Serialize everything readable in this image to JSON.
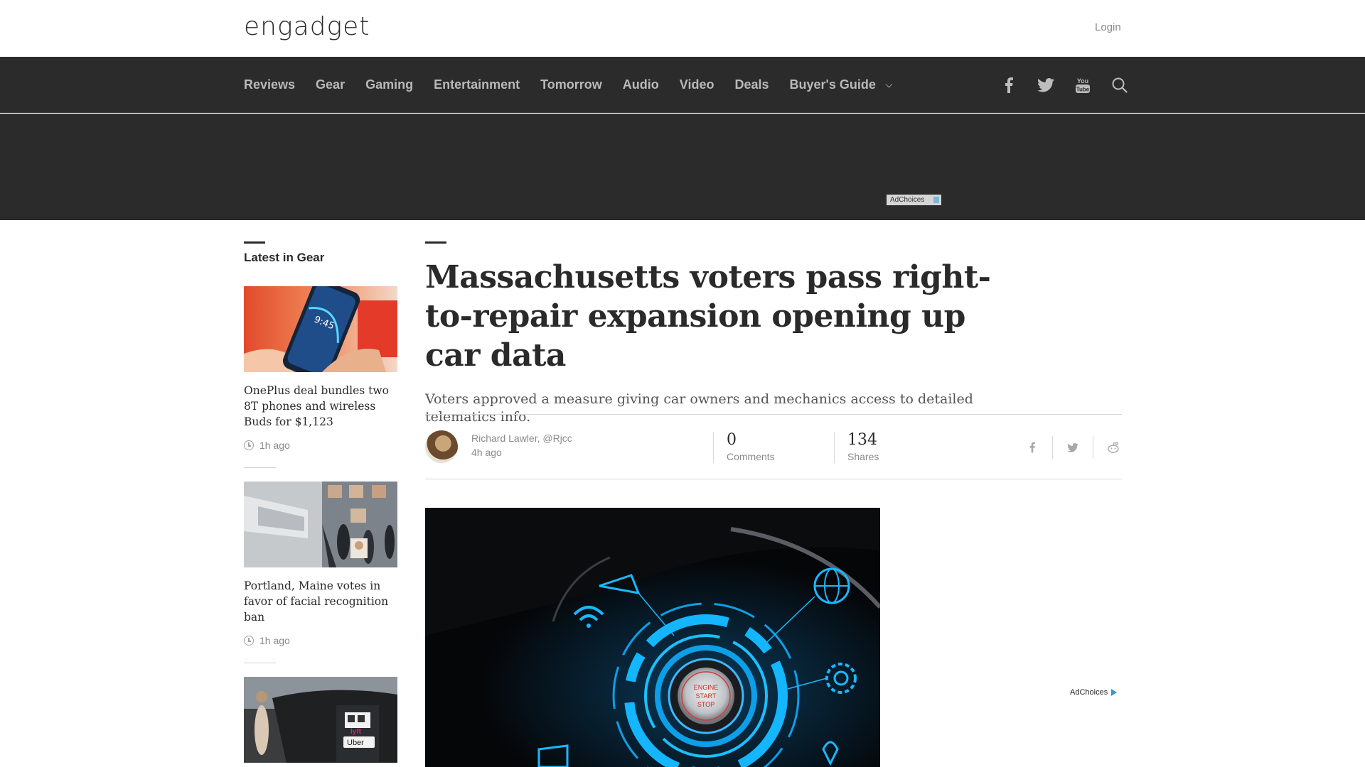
{
  "header": {
    "logo_text": "engadget",
    "login_label": "Login"
  },
  "nav": {
    "items": [
      "Reviews",
      "Gear",
      "Gaming",
      "Entertainment",
      "Tomorrow",
      "Audio",
      "Video",
      "Deals",
      "Buyer's Guide"
    ],
    "icons": [
      "facebook-icon",
      "twitter-icon",
      "youtube-icon",
      "search-icon"
    ]
  },
  "ads": {
    "adchoices_label": "AdChoices"
  },
  "sidebar": {
    "title": "Latest in Gear",
    "cards": [
      {
        "title": "OnePlus deal bundles two 8T phones and wireless Buds for $1,123",
        "time": "1h ago",
        "thumb_text": "9:45"
      },
      {
        "title": "Portland, Maine votes in favor of facial recognition ban",
        "time": "1h ago"
      },
      {
        "title": "",
        "time": ""
      }
    ]
  },
  "article": {
    "headline": "Massachusetts voters pass right-to-repair expansion opening up car data",
    "subhead": "Voters approved a measure giving car owners and mechanics access to detailed telematics info.",
    "author": "Richard Lawler, @Rjcc",
    "time": "4h ago",
    "comments": {
      "value": "0",
      "label": "Comments"
    },
    "shares": {
      "value": "134",
      "label": "Shares"
    },
    "share_icons": [
      "facebook-icon",
      "twitter-icon",
      "reddit-icon"
    ],
    "hero_button_lines": [
      "ENGINE",
      "START",
      "STOP"
    ]
  }
}
